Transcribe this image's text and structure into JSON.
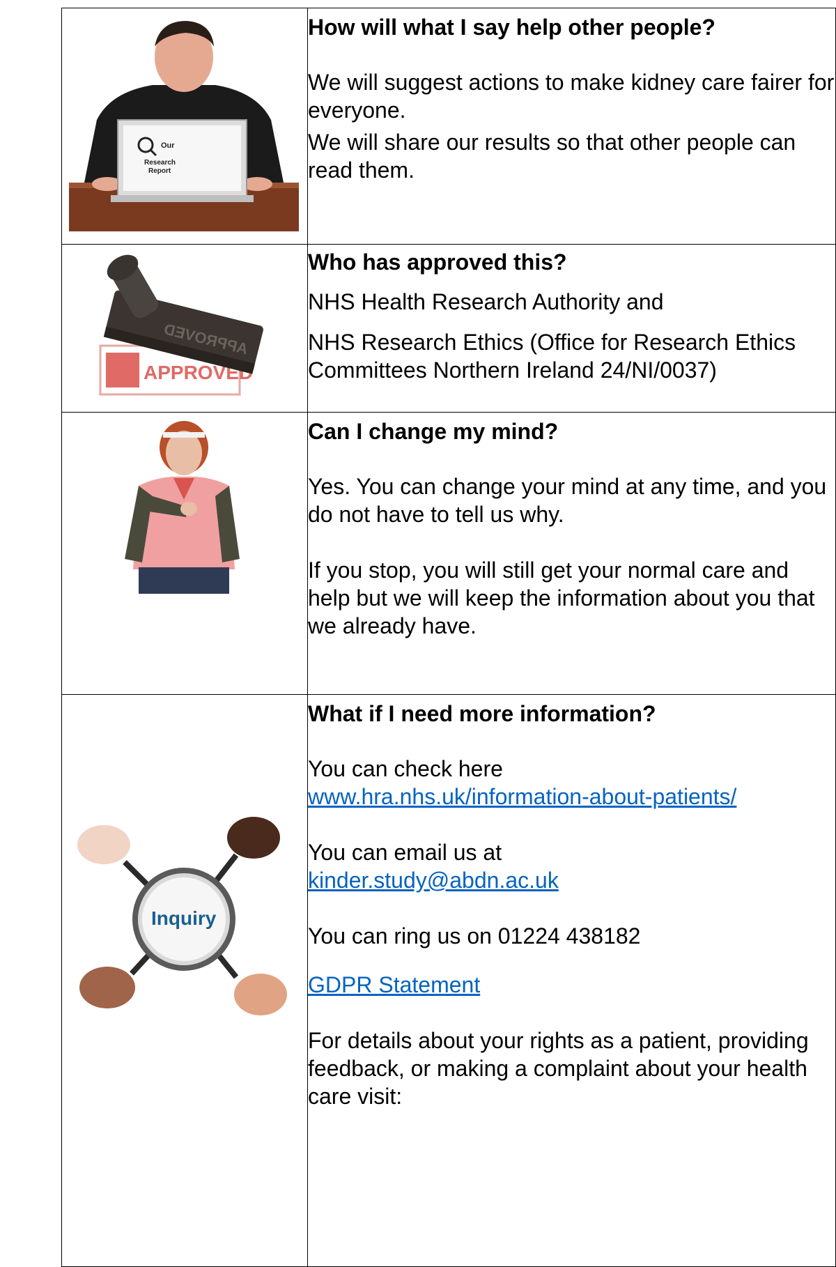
{
  "rows": [
    {
      "heading": "How will what I say help other people?",
      "p1": "We will suggest actions to make kidney care fairer for everyone.",
      "p2": "We will share our results so that other people can read them.",
      "image": {
        "name": "man-with-laptop-report",
        "laptop_title": "Our",
        "laptop_line2": "Research",
        "laptop_line3": "Report"
      }
    },
    {
      "heading": "Who has approved this?",
      "p1": "NHS Health Research Authority and",
      "p2": "NHS Research Ethics (Office for Research Ethics Committees Northern Ireland 24/NI/0037)",
      "image": {
        "name": "approved-stamp",
        "stamp_text": "APPROVED",
        "stamp_text_mirrored": "APPROVED"
      }
    },
    {
      "heading": "Can I change my mind?",
      "p1": "Yes. You can change your mind at any time, and you do not have to tell us why.",
      "p2": "If you stop, you will still get your normal care and help but we will keep the information about you that we already have.",
      "image": {
        "name": "woman-pointing-at-self"
      }
    },
    {
      "heading": "What if I need more information?",
      "check_text": "You can check here",
      "check_link": "www.hra.nhs.uk/information-about-patients/",
      "email_text": "You can email us at",
      "email_link": "kinder.study@abdn.ac.uk",
      "phone_text": "You can ring us on 01224 438182",
      "gdpr_link": "GDPR Statement",
      "details_text": "For details about your rights as a patient, providing feedback, or making a complaint about your health care visit:",
      "image": {
        "name": "magnifier-inquiry",
        "lens_text": "Inquiry"
      }
    }
  ],
  "colors": {
    "link": "#0563C1",
    "stamp_red": "#d9534f",
    "border": "#000000"
  }
}
